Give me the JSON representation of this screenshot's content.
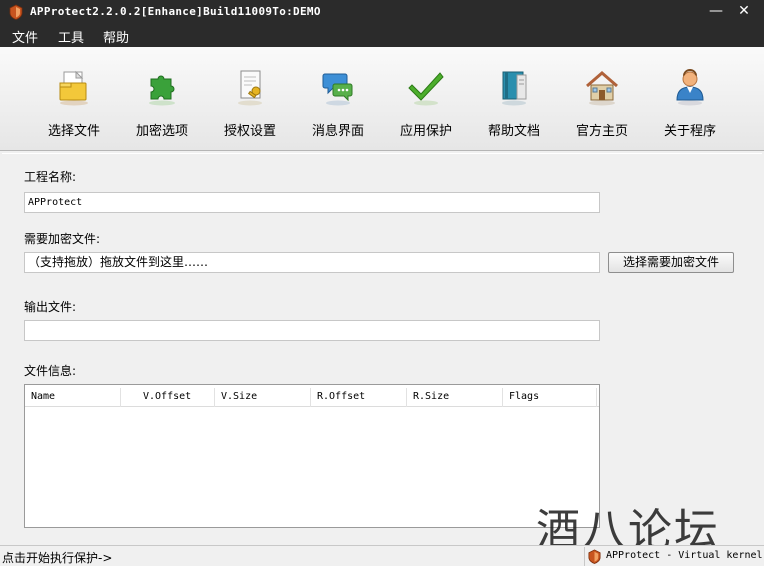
{
  "window": {
    "title": "APProtect2.2.0.2[Enhance]Build11009To:DEMO",
    "minimize_glyph": "—",
    "close_glyph": "✕"
  },
  "menu": {
    "items": [
      "文件",
      "工具",
      "帮助"
    ]
  },
  "toolbar": {
    "items": [
      {
        "label": "选择文件",
        "icon": "folder-file-icon"
      },
      {
        "label": "加密选项",
        "icon": "puzzle-icon"
      },
      {
        "label": "授权设置",
        "icon": "license-key-icon"
      },
      {
        "label": "消息界面",
        "icon": "chat-bubble-icon"
      },
      {
        "label": "应用保护",
        "icon": "checkmark-icon"
      },
      {
        "label": "帮助文档",
        "icon": "book-icon"
      },
      {
        "label": "官方主页",
        "icon": "house-icon"
      },
      {
        "label": "关于程序",
        "icon": "person-icon"
      }
    ]
  },
  "form": {
    "project_name_label": "工程名称:",
    "project_name_value": "APProtect",
    "encrypt_file_label": "需要加密文件:",
    "encrypt_file_value": "（支持拖放）拖放文件到这里……",
    "choose_file_button": "选择需要加密文件",
    "output_file_label": "输出文件:",
    "output_file_value": "",
    "file_info_label": "文件信息:"
  },
  "file_table": {
    "columns": [
      "Name",
      "V.Offset",
      "V.Size",
      "R.Offset",
      "R.Size",
      "Flags"
    ],
    "rows": []
  },
  "statusbar": {
    "left_text": "点击开始执行保护->",
    "right_text": "APProtect - Virtual kernel"
  },
  "watermark": {
    "text": "酒八论坛"
  },
  "colors": {
    "titlebar": "#2b2b2b",
    "menubar": "#2b2b2b",
    "window_bg": "#f0f0f0"
  }
}
